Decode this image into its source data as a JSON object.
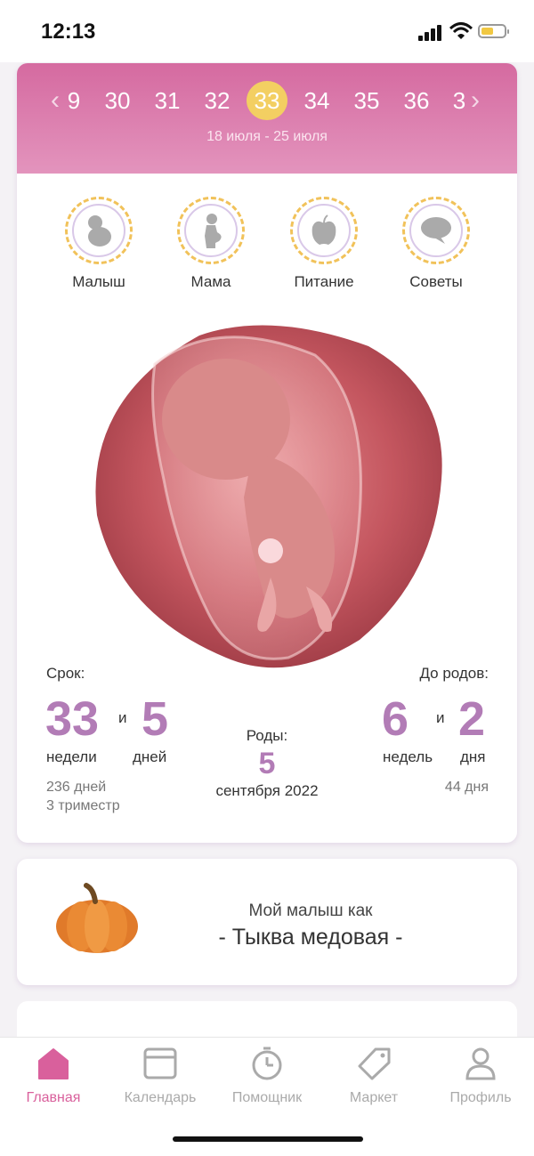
{
  "status": {
    "time": "12:13"
  },
  "weeks": {
    "items": [
      "9",
      "30",
      "31",
      "32",
      "33",
      "34",
      "35",
      "36",
      "3"
    ],
    "active": "33",
    "range": "18 июля - 25 июля"
  },
  "categories": [
    {
      "label": "Малыш",
      "icon": "baby-icon"
    },
    {
      "label": "Мама",
      "icon": "mother-icon"
    },
    {
      "label": "Питание",
      "icon": "apple-icon"
    },
    {
      "label": "Советы",
      "icon": "chat-bubble-icon"
    }
  ],
  "term": {
    "label": "Срок:",
    "weeks": "33",
    "and": "и",
    "days": "5",
    "weeks_word": "недели",
    "days_word": "дней",
    "total_days": "236 дней",
    "trimester": "3 триместр"
  },
  "birth": {
    "label": "Роды:",
    "day": "5",
    "month_year": "сентября 2022"
  },
  "until": {
    "label": "До родов:",
    "weeks": "6",
    "and": "и",
    "days": "2",
    "weeks_word": "недель",
    "days_word": "дня",
    "total_days": "44 дня"
  },
  "fruit": {
    "line1": "Мой малыш как",
    "line2": "- Тыква медовая -"
  },
  "tabs": [
    {
      "label": "Главная",
      "icon": "home-icon",
      "active": true
    },
    {
      "label": "Календарь",
      "icon": "calendar-icon"
    },
    {
      "label": "Помощник",
      "icon": "timer-icon"
    },
    {
      "label": "Маркет",
      "icon": "tag-icon"
    },
    {
      "label": "Профиль",
      "icon": "profile-icon"
    }
  ],
  "colors": {
    "accent": "#d9609c",
    "numbers": "#b27cb6",
    "active_week": "#f3cf62"
  }
}
